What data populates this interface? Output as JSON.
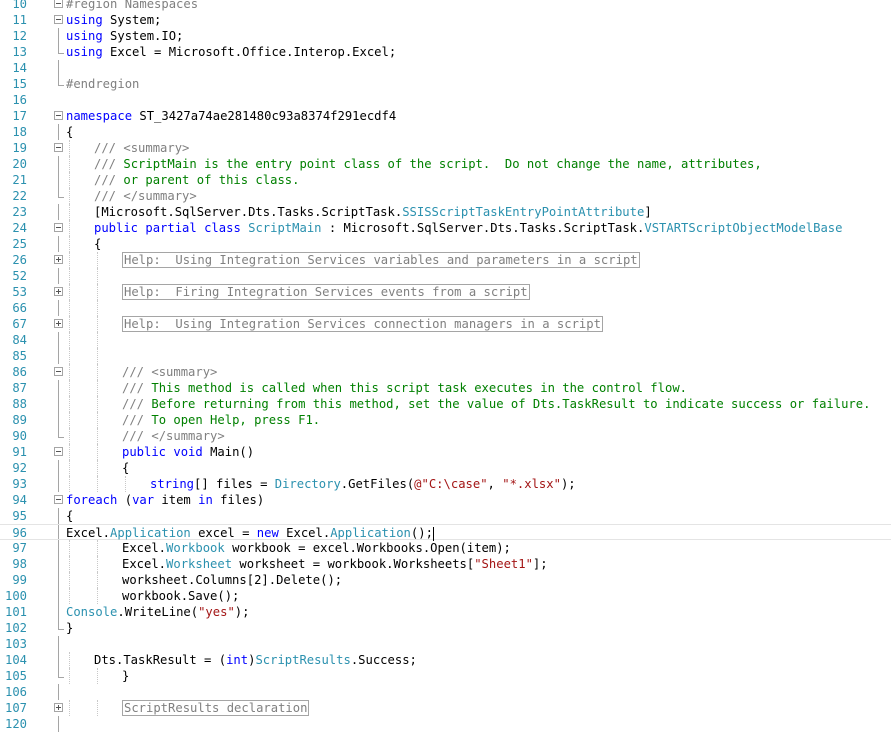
{
  "editor": {
    "lines": [
      {
        "n": "10",
        "fold": "minus",
        "indent": 0,
        "tokens": [
          {
            "t": "#region Namespaces",
            "c": "rg"
          }
        ]
      },
      {
        "n": "11",
        "fold": "minus",
        "indent": 0,
        "tokens": [
          {
            "t": "using",
            "c": "kw"
          },
          {
            "t": " System;",
            "c": ""
          }
        ]
      },
      {
        "n": "12",
        "fold": "bar",
        "indent": 0,
        "tokens": [
          {
            "t": "using",
            "c": "kw"
          },
          {
            "t": " System.IO;",
            "c": ""
          }
        ]
      },
      {
        "n": "13",
        "fold": "end",
        "indent": 0,
        "tokens": [
          {
            "t": "using",
            "c": "kw"
          },
          {
            "t": " Excel = Microsoft.Office.Interop.Excel;",
            "c": ""
          }
        ]
      },
      {
        "n": "14",
        "fold": "bar",
        "indent": 0,
        "tokens": []
      },
      {
        "n": "15",
        "fold": "end",
        "indent": 0,
        "tokens": [
          {
            "t": "#endregion",
            "c": "rg"
          }
        ]
      },
      {
        "n": "16",
        "fold": "",
        "indent": 0,
        "tokens": []
      },
      {
        "n": "17",
        "fold": "minus",
        "indent": 0,
        "tokens": [
          {
            "t": "namespace",
            "c": "kw"
          },
          {
            "t": " ST_3427a74ae281480c93a8374f291ecdf4",
            "c": ""
          }
        ]
      },
      {
        "n": "18",
        "fold": "bar",
        "indent": 0,
        "tokens": [
          {
            "t": "{",
            "c": ""
          }
        ]
      },
      {
        "n": "19",
        "fold": "minus",
        "indent": 1,
        "tokens": [
          {
            "t": "/// ",
            "c": "xd"
          },
          {
            "t": "<summary>",
            "c": "xd"
          }
        ]
      },
      {
        "n": "20",
        "fold": "bar",
        "indent": 1,
        "tokens": [
          {
            "t": "/// ",
            "c": "xd"
          },
          {
            "t": "ScriptMain is the entry point class of the script.  Do not change the name, attributes,",
            "c": "cm"
          }
        ]
      },
      {
        "n": "21",
        "fold": "bar",
        "indent": 1,
        "tokens": [
          {
            "t": "/// ",
            "c": "xd"
          },
          {
            "t": "or parent of this class.",
            "c": "cm"
          }
        ]
      },
      {
        "n": "22",
        "fold": "end",
        "indent": 1,
        "tokens": [
          {
            "t": "/// ",
            "c": "xd"
          },
          {
            "t": "</summary>",
            "c": "xd"
          }
        ]
      },
      {
        "n": "23",
        "fold": "bar",
        "indent": 1,
        "tokens": [
          {
            "t": "[Microsoft.SqlServer.Dts.Tasks.ScriptTask.",
            "c": ""
          },
          {
            "t": "SSISScriptTaskEntryPointAttribute",
            "c": "ty"
          },
          {
            "t": "]",
            "c": ""
          }
        ]
      },
      {
        "n": "24",
        "fold": "minus",
        "indent": 1,
        "tokens": [
          {
            "t": "public",
            "c": "kw"
          },
          {
            "t": " ",
            "c": ""
          },
          {
            "t": "partial",
            "c": "kw"
          },
          {
            "t": " ",
            "c": ""
          },
          {
            "t": "class",
            "c": "kw"
          },
          {
            "t": " ",
            "c": ""
          },
          {
            "t": "ScriptMain",
            "c": "ty"
          },
          {
            "t": " : Microsoft.SqlServer.Dts.Tasks.ScriptTask.",
            "c": ""
          },
          {
            "t": "VSTARTScriptObjectModelBase",
            "c": "ty"
          }
        ]
      },
      {
        "n": "25",
        "fold": "bar",
        "indent": 1,
        "tokens": [
          {
            "t": "{",
            "c": ""
          }
        ]
      },
      {
        "n": "26",
        "fold": "plus",
        "indent": 2,
        "tokens": [
          {
            "t": "Help:  Using Integration Services variables and parameters in a script",
            "c": "collapsed"
          }
        ]
      },
      {
        "n": "52",
        "fold": "bar",
        "indent": 2,
        "tokens": []
      },
      {
        "n": "53",
        "fold": "plus",
        "indent": 2,
        "tokens": [
          {
            "t": "Help:  Firing Integration Services events from a script",
            "c": "collapsed"
          }
        ]
      },
      {
        "n": "66",
        "fold": "bar",
        "indent": 2,
        "tokens": []
      },
      {
        "n": "67",
        "fold": "plus",
        "indent": 2,
        "tokens": [
          {
            "t": "Help:  Using Integration Services connection managers in a script",
            "c": "collapsed"
          }
        ]
      },
      {
        "n": "84",
        "fold": "bar",
        "indent": 2,
        "tokens": []
      },
      {
        "n": "85",
        "fold": "bar",
        "indent": 2,
        "tokens": []
      },
      {
        "n": "86",
        "fold": "minus",
        "indent": 2,
        "tokens": [
          {
            "t": "/// ",
            "c": "xd"
          },
          {
            "t": "<summary>",
            "c": "xd"
          }
        ]
      },
      {
        "n": "87",
        "fold": "bar",
        "indent": 2,
        "tokens": [
          {
            "t": "/// ",
            "c": "xd"
          },
          {
            "t": "This method is called when this script task executes in the control flow.",
            "c": "cm"
          }
        ]
      },
      {
        "n": "88",
        "fold": "bar",
        "indent": 2,
        "tokens": [
          {
            "t": "/// ",
            "c": "xd"
          },
          {
            "t": "Before returning from this method, set the value of Dts.TaskResult to indicate success or failure.",
            "c": "cm"
          }
        ]
      },
      {
        "n": "89",
        "fold": "bar",
        "indent": 2,
        "tokens": [
          {
            "t": "/// ",
            "c": "xd"
          },
          {
            "t": "To open Help, press F1.",
            "c": "cm"
          }
        ]
      },
      {
        "n": "90",
        "fold": "end",
        "indent": 2,
        "tokens": [
          {
            "t": "/// ",
            "c": "xd"
          },
          {
            "t": "</summary>",
            "c": "xd"
          }
        ]
      },
      {
        "n": "91",
        "fold": "minus",
        "indent": 2,
        "tokens": [
          {
            "t": "public",
            "c": "kw"
          },
          {
            "t": " ",
            "c": ""
          },
          {
            "t": "void",
            "c": "kw"
          },
          {
            "t": " Main()",
            "c": ""
          }
        ]
      },
      {
        "n": "92",
        "fold": "bar",
        "indent": 2,
        "tokens": [
          {
            "t": "{",
            "c": ""
          }
        ]
      },
      {
        "n": "93",
        "fold": "bar",
        "indent": 3,
        "tokens": [
          {
            "t": "string",
            "c": "kw"
          },
          {
            "t": "[] files = ",
            "c": ""
          },
          {
            "t": "Directory",
            "c": "ty"
          },
          {
            "t": ".GetFiles(",
            "c": ""
          },
          {
            "t": "@\"C:\\case\"",
            "c": "st"
          },
          {
            "t": ", ",
            "c": ""
          },
          {
            "t": "\"*.xlsx\"",
            "c": "st"
          },
          {
            "t": ");",
            "c": ""
          }
        ]
      },
      {
        "n": "94",
        "fold": "minus",
        "indent": 0,
        "tokens": [
          {
            "t": "foreach",
            "c": "kw"
          },
          {
            "t": " (",
            "c": ""
          },
          {
            "t": "var",
            "c": "kw"
          },
          {
            "t": " item ",
            "c": ""
          },
          {
            "t": "in",
            "c": "kw"
          },
          {
            "t": " files)",
            "c": ""
          }
        ]
      },
      {
        "n": "95",
        "fold": "bar",
        "indent": 0,
        "tokens": [
          {
            "t": "{",
            "c": ""
          }
        ]
      },
      {
        "n": "96",
        "fold": "bar",
        "indent": 0,
        "current": true,
        "tokens": [
          {
            "t": "Excel.",
            "c": ""
          },
          {
            "t": "Application",
            "c": "ty"
          },
          {
            "t": " excel = ",
            "c": ""
          },
          {
            "t": "new",
            "c": "kw"
          },
          {
            "t": " Excel.",
            "c": ""
          },
          {
            "t": "Application",
            "c": "ty"
          },
          {
            "t": "();",
            "c": ""
          }
        ]
      },
      {
        "n": "97",
        "fold": "bar",
        "indent": 2,
        "tokens": [
          {
            "t": "Excel.",
            "c": ""
          },
          {
            "t": "Workbook",
            "c": "ty"
          },
          {
            "t": " workbook = excel.Workbooks.Open(item);",
            "c": ""
          }
        ]
      },
      {
        "n": "98",
        "fold": "bar",
        "indent": 2,
        "tokens": [
          {
            "t": "Excel.",
            "c": ""
          },
          {
            "t": "Worksheet",
            "c": "ty"
          },
          {
            "t": " worksheet = workbook.Worksheets[",
            "c": ""
          },
          {
            "t": "\"Sheet1\"",
            "c": "st"
          },
          {
            "t": "];",
            "c": ""
          }
        ]
      },
      {
        "n": "99",
        "fold": "bar",
        "indent": 2,
        "tokens": [
          {
            "t": "worksheet.Columns[2].Delete();",
            "c": ""
          }
        ]
      },
      {
        "n": "100",
        "fold": "bar",
        "indent": 2,
        "tokens": [
          {
            "t": "workbook.Save();",
            "c": ""
          }
        ]
      },
      {
        "n": "101",
        "fold": "bar",
        "indent": 0,
        "tokens": [
          {
            "t": "Console",
            "c": "ty"
          },
          {
            "t": ".WriteLine(",
            "c": ""
          },
          {
            "t": "\"yes\"",
            "c": "st"
          },
          {
            "t": ");",
            "c": ""
          }
        ]
      },
      {
        "n": "102",
        "fold": "end",
        "indent": 0,
        "tokens": [
          {
            "t": "}",
            "c": ""
          }
        ]
      },
      {
        "n": "103",
        "fold": "bar",
        "indent": 0,
        "tokens": []
      },
      {
        "n": "104",
        "fold": "bar",
        "indent": 1,
        "tokens": [
          {
            "t": "Dts.TaskResult = (",
            "c": ""
          },
          {
            "t": "int",
            "c": "kw"
          },
          {
            "t": ")",
            "c": ""
          },
          {
            "t": "ScriptResults",
            "c": "ty"
          },
          {
            "t": ".Success;",
            "c": ""
          }
        ]
      },
      {
        "n": "105",
        "fold": "end",
        "indent": 2,
        "tokens": [
          {
            "t": "}",
            "c": ""
          }
        ]
      },
      {
        "n": "106",
        "fold": "bar",
        "indent": 0,
        "tokens": []
      },
      {
        "n": "107",
        "fold": "plus",
        "indent": 2,
        "tokens": [
          {
            "t": "ScriptResults declaration",
            "c": "collapsed"
          }
        ]
      },
      {
        "n": "120",
        "fold": "bar",
        "indent": 0,
        "tokens": []
      }
    ]
  }
}
